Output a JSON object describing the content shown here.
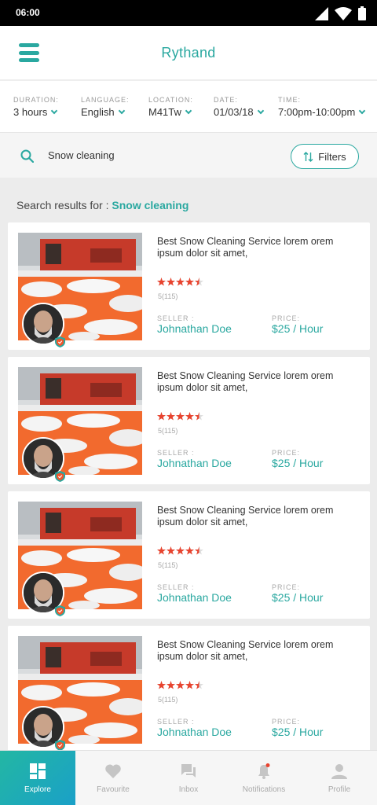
{
  "status": {
    "time": "06:00"
  },
  "app": {
    "title": "Rythand"
  },
  "filters": [
    {
      "label": "DURATION:",
      "value": "3 hours"
    },
    {
      "label": "LANGUAGE:",
      "value": "English"
    },
    {
      "label": "LOCATION:",
      "value": "M41Tw"
    },
    {
      "label": "DATE:",
      "value": "01/03/18"
    },
    {
      "label": "TIME:",
      "value": "7:00pm-10:00pm"
    }
  ],
  "search": {
    "value": "Snow cleaning",
    "filters_label": "Filters"
  },
  "results": {
    "prefix": "Search results for : ",
    "query": "Snow cleaning"
  },
  "listings": [
    {
      "title": "Best Snow Cleaning Service lorem orem ipsum dolor sit amet,",
      "rating": 4.5,
      "rating_text": "5(115)",
      "seller_label": "SELLER :",
      "seller": "Johnathan Doe",
      "price_label": "PRICE:",
      "price": "$25 / Hour"
    },
    {
      "title": "Best Snow Cleaning Service lorem orem ipsum dolor sit amet,",
      "rating": 4.5,
      "rating_text": "5(115)",
      "seller_label": "SELLER :",
      "seller": "Johnathan Doe",
      "price_label": "PRICE:",
      "price": "$25 / Hour"
    },
    {
      "title": "Best Snow Cleaning Service lorem orem ipsum dolor sit amet,",
      "rating": 4.5,
      "rating_text": "5(115)",
      "seller_label": "SELLER :",
      "seller": "Johnathan Doe",
      "price_label": "PRICE:",
      "price": "$25 / Hour"
    },
    {
      "title": "Best Snow Cleaning Service lorem orem ipsum dolor sit amet,",
      "rating": 4.5,
      "rating_text": "5(115)",
      "seller_label": "SELLER :",
      "seller": "Johnathan Doe",
      "price_label": "PRICE:",
      "price": "$25 / Hour"
    }
  ],
  "nav": [
    {
      "label": "Explore",
      "icon": "explore-icon",
      "active": true
    },
    {
      "label": "Favourite",
      "icon": "heart-icon",
      "active": false
    },
    {
      "label": "Inbox",
      "icon": "chat-icon",
      "active": false
    },
    {
      "label": "Notifications",
      "icon": "bell-icon",
      "active": false
    },
    {
      "label": "Profile",
      "icon": "user-icon",
      "active": false
    }
  ],
  "colors": {
    "accent": "#2aa8a0",
    "star": "#e8432e",
    "plow": "#f26a2e"
  }
}
